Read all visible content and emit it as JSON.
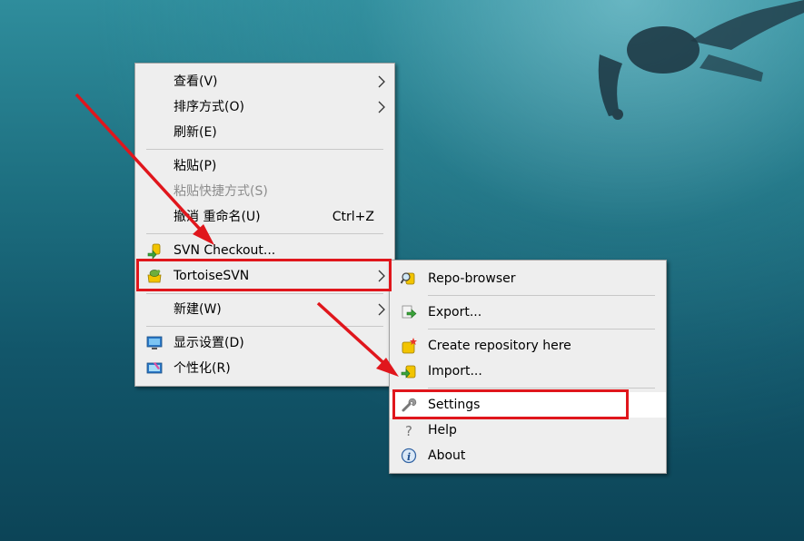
{
  "context_menu": {
    "items": [
      {
        "label": "查看(V)"
      },
      {
        "label": "排序方式(O)"
      },
      {
        "label": "刷新(E)"
      },
      {
        "label": "粘贴(P)"
      },
      {
        "label": "粘贴快捷方式(S)"
      },
      {
        "label": "撤消 重命名(U)",
        "shortcut": "Ctrl+Z"
      },
      {
        "label": "SVN Checkout...",
        "icon": "svn-checkout-icon"
      },
      {
        "label": "TortoiseSVN",
        "icon": "tortoisesvn-icon"
      },
      {
        "label": "新建(W)"
      },
      {
        "label": "显示设置(D)",
        "icon": "display-settings-icon"
      },
      {
        "label": "个性化(R)",
        "icon": "personalize-icon"
      }
    ]
  },
  "submenu": {
    "items": [
      {
        "label": "Repo-browser",
        "icon": "repo-browser-icon"
      },
      {
        "label": "Export...",
        "icon": "export-icon"
      },
      {
        "label": "Create repository here",
        "icon": "create-repository-icon"
      },
      {
        "label": "Import...",
        "icon": "import-icon"
      },
      {
        "label": "Settings",
        "icon": "wrench-icon"
      },
      {
        "label": "Help",
        "icon": "help-icon"
      },
      {
        "label": "About",
        "icon": "info-icon"
      }
    ]
  },
  "annotations": {
    "color": "#e0161c"
  },
  "colors": {
    "menu_background": "#eeeeee",
    "highlight": "#ffffff",
    "disabled_text": "#8c8c8c"
  }
}
